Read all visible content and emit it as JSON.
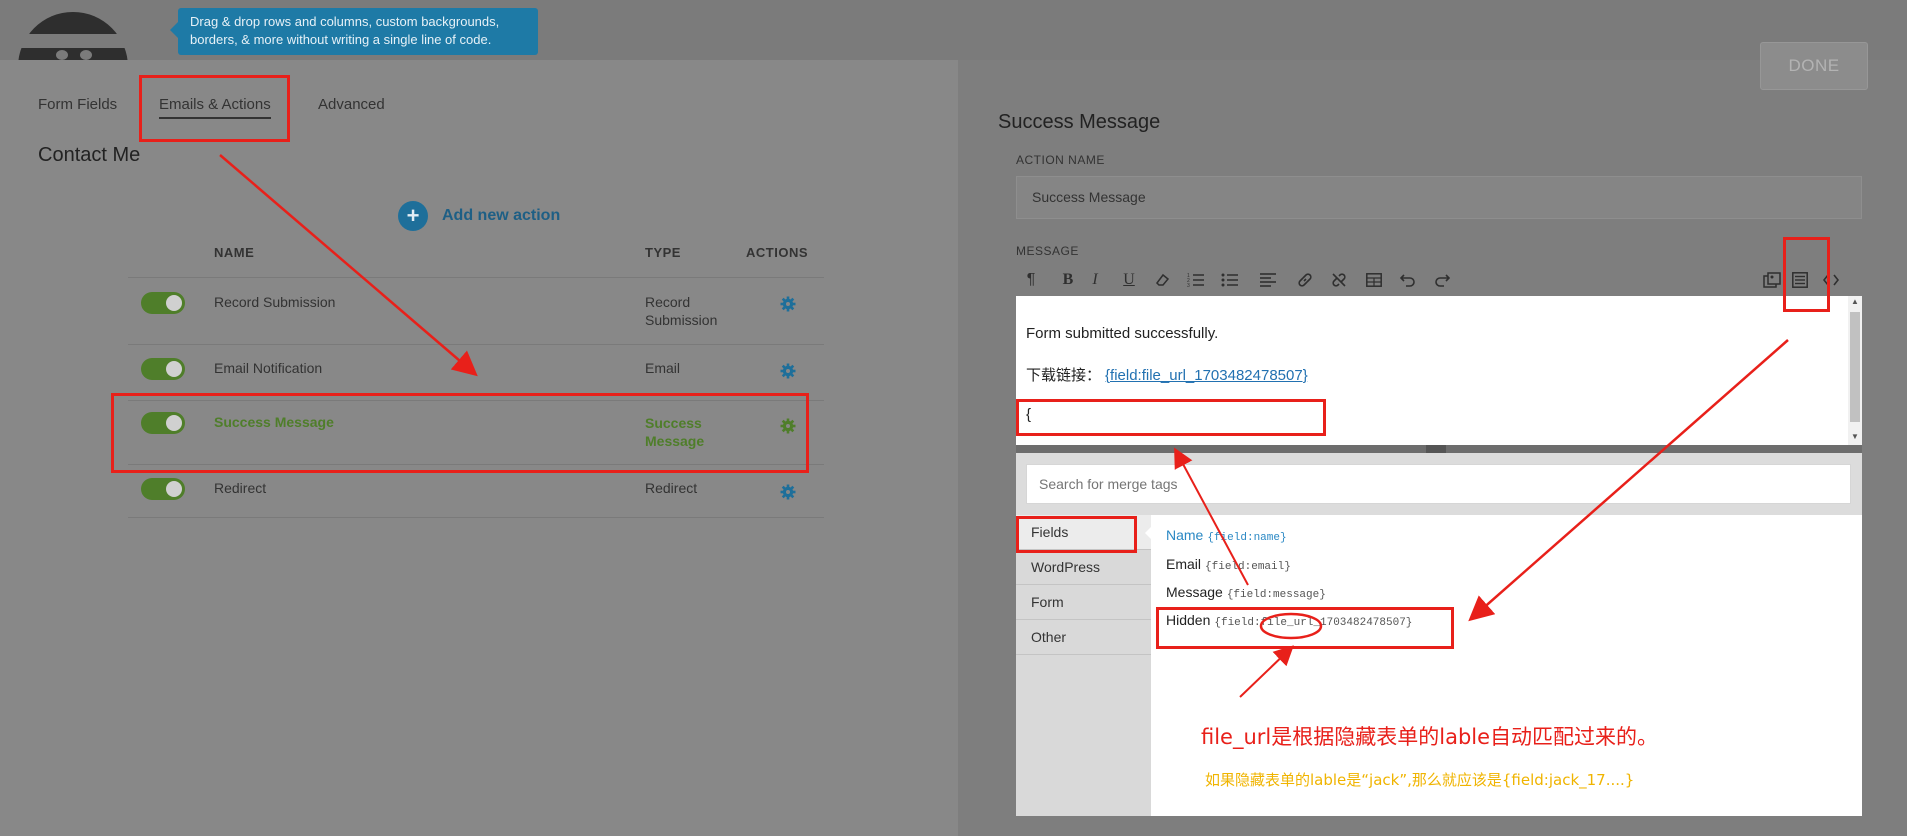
{
  "header": {
    "tooltip_line1": "Drag & drop rows and columns, custom backgrounds,",
    "tooltip_line2": "borders, & more without writing a single line of code.",
    "done_label": "DONE"
  },
  "tabs": {
    "form_fields": "Form Fields",
    "emails_actions": "Emails & Actions",
    "advanced": "Advanced"
  },
  "form_title": "Contact Me",
  "add_action_label": "Add new action",
  "table": {
    "headers": {
      "name": "NAME",
      "type": "TYPE",
      "actions": "ACTIONS"
    },
    "rows": [
      {
        "name": "Record Submission",
        "type_line1": "Record",
        "type_line2": "Submission",
        "enabled": true
      },
      {
        "name": "Email Notification",
        "type_line1": "Email",
        "type_line2": "",
        "enabled": true
      },
      {
        "name": "Success Message",
        "type_line1": "Success",
        "type_line2": "Message",
        "enabled": true
      },
      {
        "name": "Redirect",
        "type_line1": "Redirect",
        "type_line2": "",
        "enabled": true
      }
    ]
  },
  "panel": {
    "title": "Success Message",
    "action_name_label": "ACTION NAME",
    "action_name_value": "Success Message",
    "message_label": "MESSAGE",
    "editor": {
      "line1": "Form submitted successfully.",
      "line2_prefix": "下载链接：",
      "line2_link": "{field:file_url_1703482478507}",
      "line3": "{"
    }
  },
  "merge_tags": {
    "search_placeholder": "Search for merge tags",
    "categories": [
      "Fields",
      "WordPress",
      "Form",
      "Other"
    ],
    "fields": [
      {
        "label": "Name",
        "tag": "{field:name}"
      },
      {
        "label": "Email",
        "tag": "{field:email}"
      },
      {
        "label": "Message",
        "tag": "{field:message}"
      },
      {
        "label": "Hidden",
        "tag": "{field:file_url_1703482478507}"
      }
    ]
  },
  "annotations": {
    "note1": "file_url是根据隐藏表单的lable自动匹配过来的。",
    "note2": "如果隐藏表单的lable是“jack”,那么就应该是{field:jack_17....}"
  },
  "colors": {
    "annotation_red": "#e8201a",
    "annotation_yellow": "#f0b400",
    "toggle_green": "#4f7e2a",
    "brand_blue": "#1e6f9a"
  }
}
